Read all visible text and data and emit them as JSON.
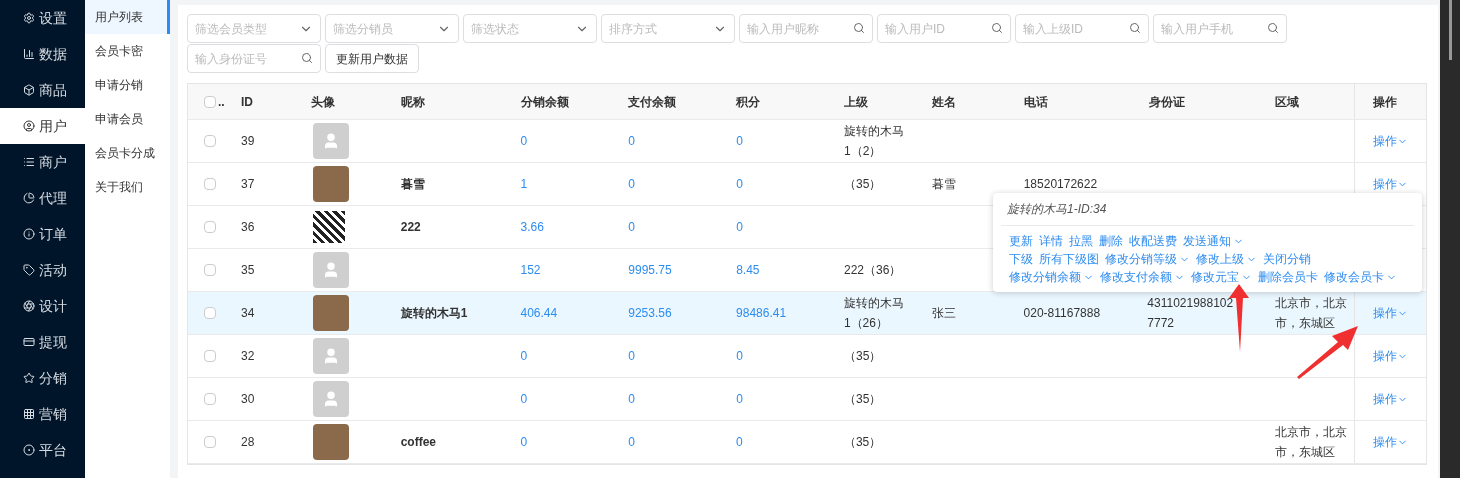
{
  "sidebar": {
    "items": [
      {
        "label": "设置",
        "selected": false
      },
      {
        "label": "数据",
        "selected": false
      },
      {
        "label": "商品",
        "selected": false
      },
      {
        "label": "用户",
        "selected": true
      },
      {
        "label": "商户",
        "selected": false
      },
      {
        "label": "代理",
        "selected": false
      },
      {
        "label": "订单",
        "selected": false
      },
      {
        "label": "活动",
        "selected": false
      },
      {
        "label": "设计",
        "selected": false
      },
      {
        "label": "提现",
        "selected": false
      },
      {
        "label": "分销",
        "selected": false
      },
      {
        "label": "营销",
        "selected": false
      },
      {
        "label": "平台",
        "selected": false
      }
    ]
  },
  "submenu": {
    "items": [
      {
        "label": "用户列表",
        "selected": true
      },
      {
        "label": "会员卡密",
        "selected": false
      },
      {
        "label": "申请分销",
        "selected": false
      },
      {
        "label": "申请会员",
        "selected": false
      },
      {
        "label": "会员卡分成",
        "selected": false
      },
      {
        "label": "关于我们",
        "selected": false
      }
    ]
  },
  "filters": [
    {
      "kind": "select",
      "placeholder": "筛选会员类型"
    },
    {
      "kind": "select",
      "placeholder": "筛选分销员"
    },
    {
      "kind": "select",
      "placeholder": "筛选状态"
    },
    {
      "kind": "select",
      "placeholder": "排序方式"
    },
    {
      "kind": "search",
      "placeholder": "输入用户昵称"
    },
    {
      "kind": "search",
      "placeholder": "输入用户ID"
    },
    {
      "kind": "search",
      "placeholder": "输入上级ID"
    },
    {
      "kind": "search",
      "placeholder": "输入用户手机"
    },
    {
      "kind": "search",
      "placeholder": "输入身份证号"
    },
    {
      "kind": "button",
      "label": "更新用户数据"
    }
  ],
  "table": {
    "select_all_label": "..",
    "all_checked": false,
    "columns": [
      "ID",
      "头像",
      "昵称",
      "分销余额",
      "支付余额",
      "积分",
      "上级",
      "姓名",
      "电话",
      "身份证",
      "区域",
      "操作"
    ],
    "rows": [
      {
        "selected": false,
        "checked": false,
        "id": "39",
        "avatar": {
          "kind": "default"
        },
        "nickname": "",
        "distribution": "0",
        "payment": "0",
        "points": "0",
        "parent": "旋转的木马1（2）",
        "name": "",
        "phone": "",
        "id_card": "",
        "region": "",
        "action": "操作"
      },
      {
        "selected": false,
        "checked": false,
        "id": "37",
        "avatar": {
          "kind": "photo"
        },
        "nickname": "暮雪",
        "distribution": "1",
        "payment": "0",
        "points": "0",
        "parent": "（35）",
        "name": "暮雪",
        "phone": "18520172622",
        "id_card": "",
        "region": "",
        "action": "操作"
      },
      {
        "selected": false,
        "checked": false,
        "id": "36",
        "avatar": {
          "kind": "qr"
        },
        "nickname": "222",
        "distribution": "3.66",
        "payment": "0",
        "points": "0",
        "parent": "",
        "name": "",
        "phone": "",
        "id_card": "",
        "region": "",
        "action": ""
      },
      {
        "selected": false,
        "checked": false,
        "id": "35",
        "avatar": {
          "kind": "default"
        },
        "nickname": "",
        "distribution": "152",
        "payment": "9995.75",
        "points": "8.45",
        "parent": "222（36）",
        "name": "",
        "phone": "",
        "id_card": "",
        "region": "",
        "action": ""
      },
      {
        "selected": true,
        "checked": false,
        "id": "34",
        "avatar": {
          "kind": "photo"
        },
        "nickname": "旋转的木马1",
        "distribution": "406.44",
        "payment": "9253.56",
        "points": "98486.41",
        "parent": "旋转的木马1（26）",
        "name": "张三",
        "phone": "020-81167888",
        "id_card": [
          "4311021988102",
          "7772"
        ],
        "region": "北京市，北京市，东城区",
        "action": "操作"
      },
      {
        "selected": false,
        "checked": false,
        "id": "32",
        "avatar": {
          "kind": "default"
        },
        "nickname": "",
        "distribution": "0",
        "payment": "0",
        "points": "0",
        "parent": "（35）",
        "name": "",
        "phone": "",
        "id_card": "",
        "region": "",
        "action": "操作"
      },
      {
        "selected": false,
        "checked": false,
        "id": "30",
        "avatar": {
          "kind": "default"
        },
        "nickname": "",
        "distribution": "0",
        "payment": "0",
        "points": "0",
        "parent": "（35）",
        "name": "",
        "phone": "",
        "id_card": "",
        "region": "",
        "action": "操作"
      },
      {
        "selected": false,
        "checked": false,
        "id": "28",
        "avatar": {
          "kind": "photo"
        },
        "nickname": "coffee",
        "distribution": "0",
        "payment": "0",
        "points": "0",
        "parent": "（35）",
        "name": "",
        "phone": "",
        "id_card": "",
        "region": "北京市，北京市，东城区",
        "action": "操作"
      }
    ]
  },
  "popover": {
    "title": "旋转的木马1-ID:34",
    "lines": [
      [
        {
          "label": "更新",
          "caret": false
        },
        {
          "label": "详情",
          "caret": false
        },
        {
          "label": "拉黑",
          "caret": false
        },
        {
          "label": "删除",
          "caret": false
        },
        {
          "label": "收配送费",
          "caret": false
        },
        {
          "label": "发送通知",
          "caret": true
        }
      ],
      [
        {
          "label": "下级",
          "caret": false
        },
        {
          "label": "所有下级图",
          "caret": false
        },
        {
          "label": "修改分销等级",
          "caret": true
        },
        {
          "label": "修改上级",
          "caret": true
        },
        {
          "label": "关闭分销",
          "caret": false
        }
      ],
      [
        {
          "label": "修改分销余额",
          "caret": true
        },
        {
          "label": "修改支付余额",
          "caret": true
        },
        {
          "label": "修改元宝",
          "caret": true
        },
        {
          "label": "删除会员卡",
          "caret": false
        },
        {
          "label": "修改会员卡",
          "caret": true
        }
      ]
    ]
  }
}
